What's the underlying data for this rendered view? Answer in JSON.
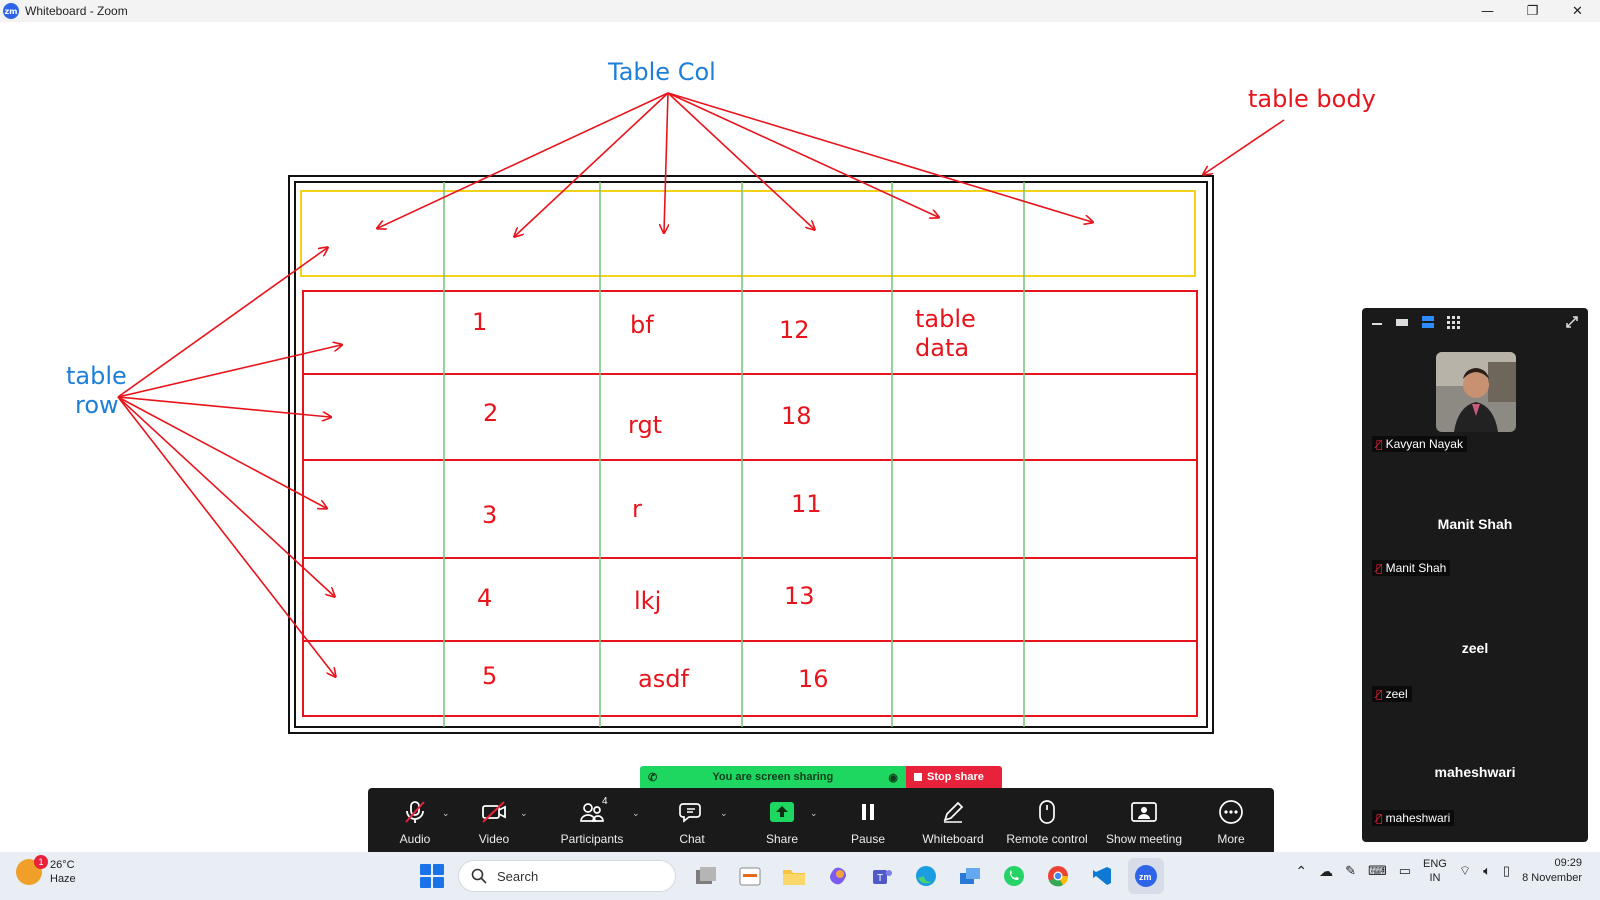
{
  "window": {
    "app_logo": "zm",
    "title": "Whiteboard - Zoom",
    "controls": {
      "minimize": "—",
      "restore": "❐",
      "close": "✕"
    }
  },
  "whiteboard": {
    "annotations": {
      "table_col": "Table Col",
      "table_body": "table body",
      "table_row_line1": "table",
      "table_row_line2": "row",
      "table_data_line1": "table",
      "table_data_line2": "data"
    },
    "rows": [
      {
        "num": "1",
        "text": "bf",
        "value": "12"
      },
      {
        "num": "2",
        "text": "rgt",
        "value": "18"
      },
      {
        "num": "3",
        "text": "r",
        "value": "11"
      },
      {
        "num": "4",
        "text": "lkj",
        "value": "13"
      },
      {
        "num": "5",
        "text": "asdf",
        "value": "16"
      }
    ],
    "colors": {
      "red": "#e8141c",
      "blue": "#1e7fd8",
      "green": "#7cc77c",
      "yellow": "#f5d21a"
    }
  },
  "share_banner": {
    "message": "You are screen sharing",
    "stop_label": "Stop share"
  },
  "toolbar": {
    "audio": "Audio",
    "video": "Video",
    "participants": "Participants",
    "participants_count": "4",
    "chat": "Chat",
    "share": "Share",
    "pause": "Pause",
    "whiteboard": "Whiteboard",
    "remote_control": "Remote control",
    "show_meeting": "Show meeting",
    "more": "More"
  },
  "gallery": {
    "participants": [
      {
        "label": "Kavyan Nayak",
        "display": ""
      },
      {
        "label": "Manit Shah",
        "display": "Manit Shah"
      },
      {
        "label": "zeel",
        "display": "zeel"
      },
      {
        "label": "maheshwari",
        "display": "maheshwari"
      }
    ]
  },
  "taskbar": {
    "weather_temp": "26°C",
    "weather_desc": "Haze",
    "weather_badge": "1",
    "search_placeholder": "Search",
    "lang_top": "ENG",
    "lang_bottom": "IN",
    "time": "09:29",
    "date": "8 November",
    "apps": [
      "file-explorer-icon",
      "store-icon",
      "folder-icon",
      "copilot-icon",
      "teams-icon",
      "edge-icon",
      "remote-desktop-icon",
      "whatsapp-icon",
      "chrome-icon",
      "vscode-icon",
      "zoom-icon"
    ]
  }
}
